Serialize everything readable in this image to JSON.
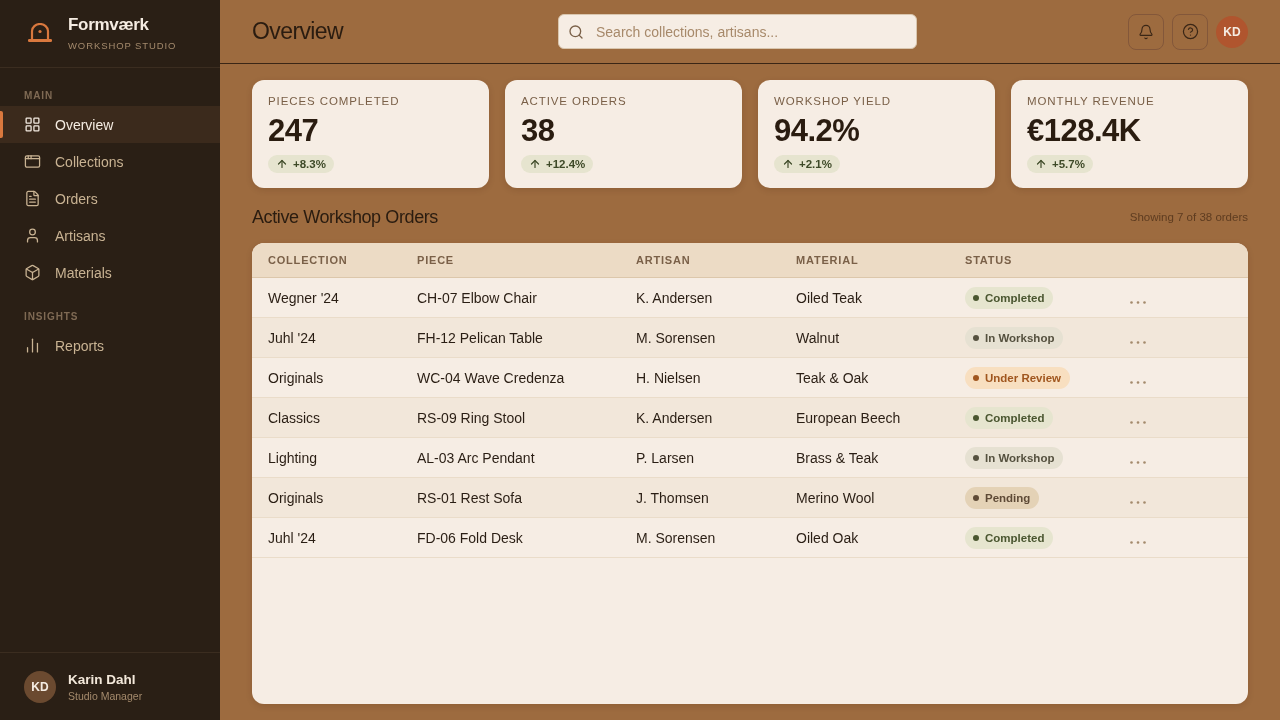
{
  "sidebar": {
    "brand": {
      "name": "Formværk",
      "tagline": "WORKSHOP STUDIO"
    },
    "sections": [
      {
        "title": "MAIN",
        "items": [
          {
            "label": "Overview",
            "selected": true
          },
          {
            "label": "Collections",
            "selected": false
          },
          {
            "label": "Orders",
            "selected": false
          },
          {
            "label": "Artisans",
            "selected": false
          },
          {
            "label": "Materials",
            "selected": false
          }
        ]
      },
      {
        "title": "INSIGHTS",
        "items": [
          {
            "label": "Reports",
            "selected": false
          }
        ]
      }
    ],
    "user": {
      "initials": "KD",
      "name": "Karin Dahl",
      "role": "Studio Manager"
    }
  },
  "header": {
    "title": "Overview",
    "search": {
      "placeholder": "Search collections, artisans..."
    },
    "user_initials": "KD"
  },
  "stats": [
    {
      "label": "PIECES COMPLETED",
      "value": "247",
      "change": "+8.3%"
    },
    {
      "label": "ACTIVE ORDERS",
      "value": "38",
      "change": "+12.4%"
    },
    {
      "label": "WORKSHOP YIELD",
      "value": "94.2%",
      "change": "+2.1%"
    },
    {
      "label": "MONTHLY REVENUE",
      "value": "€128.4K",
      "change": "+5.7%"
    }
  ],
  "orders": {
    "title": "Active Workshop Orders",
    "summary": "Showing 7 of 38 orders",
    "columns": [
      "COLLECTION",
      "PIECE",
      "ARTISAN",
      "MATERIAL",
      "STATUS"
    ],
    "rows": [
      {
        "collection": "Wegner '24",
        "piece": "CH-07 Elbow Chair",
        "artisan": "K. Andersen",
        "material": "Oiled Teak",
        "status": {
          "label": "Completed",
          "kind": "completed"
        }
      },
      {
        "collection": "Juhl '24",
        "piece": "FH-12 Pelican Table",
        "artisan": "M. Sorensen",
        "material": "Walnut",
        "status": {
          "label": "In Workshop",
          "kind": "workshop"
        }
      },
      {
        "collection": "Originals",
        "piece": "WC-04 Wave Credenza",
        "artisan": "H. Nielsen",
        "material": "Teak & Oak",
        "status": {
          "label": "Under Review",
          "kind": "review"
        }
      },
      {
        "collection": "Classics",
        "piece": "RS-09 Ring Stool",
        "artisan": "K. Andersen",
        "material": "European Beech",
        "status": {
          "label": "Completed",
          "kind": "completed"
        }
      },
      {
        "collection": "Lighting",
        "piece": "AL-03 Arc Pendant",
        "artisan": "P. Larsen",
        "material": "Brass & Teak",
        "status": {
          "label": "In Workshop",
          "kind": "workshop"
        }
      },
      {
        "collection": "Originals",
        "piece": "RS-01 Rest Sofa",
        "artisan": "J. Thomsen",
        "material": "Merino Wool",
        "status": {
          "label": "Pending",
          "kind": "pending"
        }
      },
      {
        "collection": "Juhl '24",
        "piece": "FD-06 Fold Desk",
        "artisan": "M. Sorensen",
        "material": "Oiled Oak",
        "status": {
          "label": "Completed",
          "kind": "completed"
        }
      }
    ]
  }
}
